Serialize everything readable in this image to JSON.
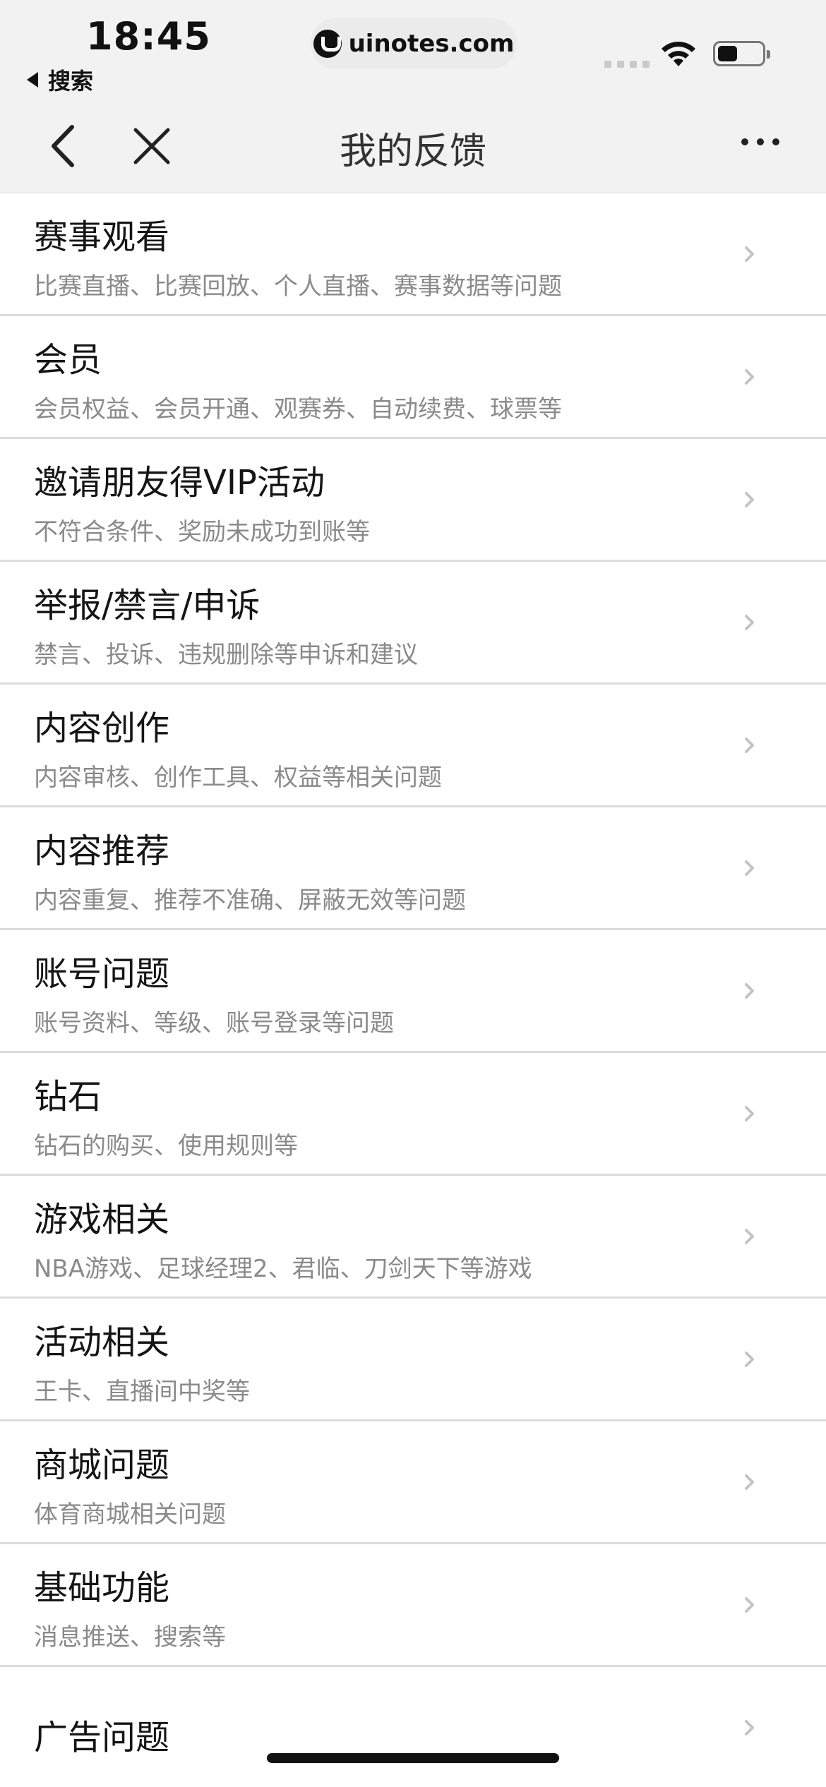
{
  "status_bar": {
    "time": "18:45",
    "back_label": "搜索",
    "url": "uinotes.com",
    "battery_level": 0.45
  },
  "nav": {
    "title": "我的反馈"
  },
  "items": [
    {
      "title": "赛事观看",
      "subtitle": "比赛直播、比赛回放、个人直播、赛事数据等问题"
    },
    {
      "title": "会员",
      "subtitle": "会员权益、会员开通、观赛券、自动续费、球票等"
    },
    {
      "title": "邀请朋友得VIP活动",
      "subtitle": "不符合条件、奖励未成功到账等"
    },
    {
      "title": "举报/禁言/申诉",
      "subtitle": "禁言、投诉、违规删除等申诉和建议"
    },
    {
      "title": "内容创作",
      "subtitle": "内容审核、创作工具、权益等相关问题"
    },
    {
      "title": "内容推荐",
      "subtitle": "内容重复、推荐不准确、屏蔽无效等问题"
    },
    {
      "title": "账号问题",
      "subtitle": "账号资料、等级、账号登录等问题"
    },
    {
      "title": "钻石",
      "subtitle": "钻石的购买、使用规则等"
    },
    {
      "title": "游戏相关",
      "subtitle": "NBA游戏、足球经理2、君临、刀剑天下等游戏"
    },
    {
      "title": "活动相关",
      "subtitle": "王卡、直播间中奖等"
    },
    {
      "title": "商城问题",
      "subtitle": "体育商城相关问题"
    },
    {
      "title": "基础功能",
      "subtitle": "消息推送、搜索等"
    },
    {
      "title": "广告问题",
      "subtitle": ""
    }
  ]
}
